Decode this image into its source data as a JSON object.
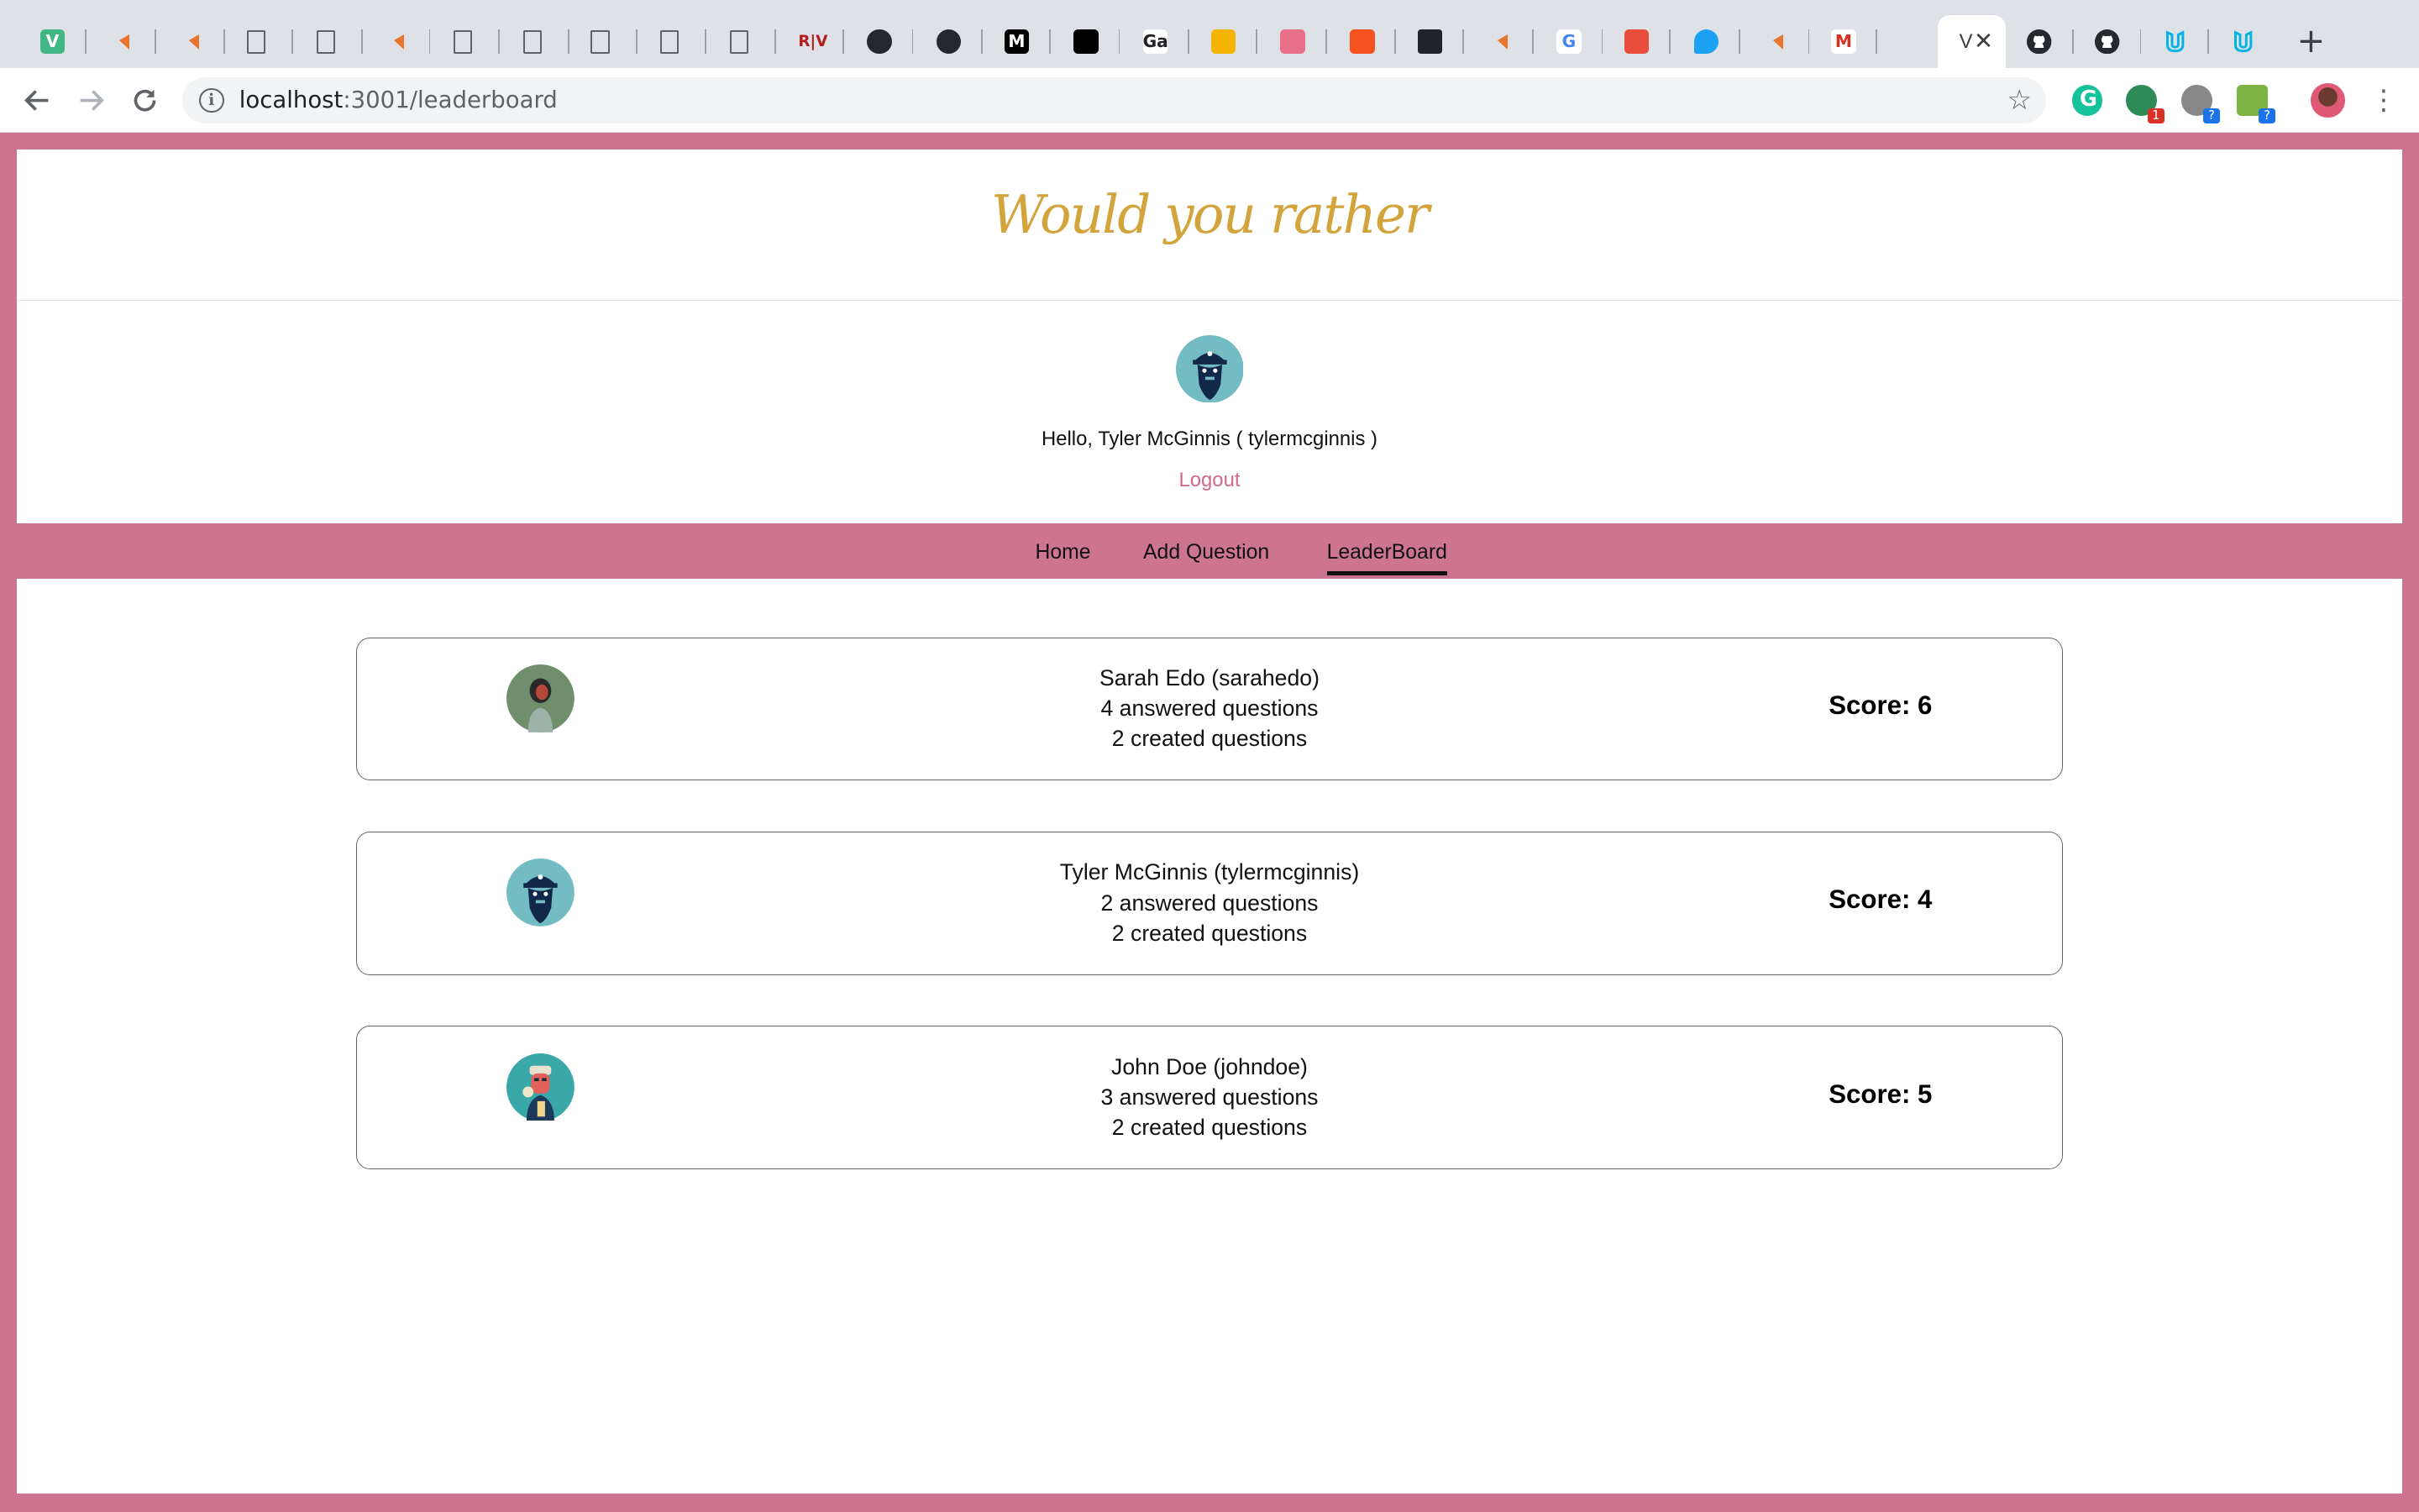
{
  "browser": {
    "tabs": [
      {
        "icon": "vue-icon",
        "label": "V",
        "color": "#41b883"
      },
      {
        "icon": "bookmark-arrow-icon",
        "label": "",
        "color": "#e8742d"
      },
      {
        "icon": "bookmark-arrow-icon",
        "label": "",
        "color": "#e8742d"
      },
      {
        "icon": "document-icon",
        "label": "",
        "color": "#5f6368"
      },
      {
        "icon": "document-icon",
        "label": "",
        "color": "#5f6368"
      },
      {
        "icon": "bookmark-arrow-icon",
        "label": "",
        "color": "#e8742d"
      },
      {
        "icon": "document-icon",
        "label": "",
        "color": "#5f6368"
      },
      {
        "icon": "document-icon",
        "label": "",
        "color": "#5f6368"
      },
      {
        "icon": "document-icon",
        "label": "",
        "color": "#5f6368"
      },
      {
        "icon": "document-icon",
        "label": "",
        "color": "#5f6368"
      },
      {
        "icon": "document-icon",
        "label": "",
        "color": "#5f6368"
      },
      {
        "icon": "rv-icon",
        "label": "R|V",
        "color": "#b31d1d"
      },
      {
        "icon": "github-icon",
        "label": "",
        "color": "#24292e"
      },
      {
        "icon": "github-icon",
        "label": "",
        "color": "#24292e"
      },
      {
        "icon": "medium-icon",
        "label": "M",
        "color": "#000000"
      },
      {
        "icon": "patreon-icon",
        "label": "",
        "color": "#000000"
      },
      {
        "icon": "ga-icon",
        "label": "Ga",
        "color": "#202124"
      },
      {
        "icon": "slides-icon",
        "label": "",
        "color": "#f4b400"
      },
      {
        "icon": "smile-icon",
        "label": "",
        "color": "#e86f8a"
      },
      {
        "icon": "laravel-icon",
        "label": "",
        "color": "#f4511e"
      },
      {
        "icon": "react-icon",
        "label": "",
        "color": "#61dafb"
      },
      {
        "icon": "bookmark-arrow-icon",
        "label": "",
        "color": "#e8742d"
      },
      {
        "icon": "google-icon",
        "label": "G",
        "color": "#4285f4"
      },
      {
        "icon": "stack-icon",
        "label": "",
        "color": "#e94e3d"
      },
      {
        "icon": "twitter-icon",
        "label": "",
        "color": "#1da1f2"
      },
      {
        "icon": "bookmark-arrow-icon",
        "label": "",
        "color": "#e8742d"
      },
      {
        "icon": "gmail-icon",
        "label": "M",
        "color": "#d93025"
      },
      {
        "icon": "audio-icon",
        "label": "",
        "color": "#5f6368"
      }
    ],
    "active_tab": {
      "label": "V",
      "close": "✕"
    },
    "trailing_tabs": [
      {
        "icon": "github-icon",
        "color": "#24292e"
      },
      {
        "icon": "github-icon",
        "color": "#24292e"
      },
      {
        "icon": "udacity-icon",
        "color": "#02b3e4"
      },
      {
        "icon": "udacity-icon",
        "color": "#02b3e4"
      }
    ],
    "new_tab": "+",
    "url_host": "localhost",
    "url_path": ":3001/leaderboard"
  },
  "app": {
    "title": "Would you rather",
    "greeting": "Hello, Tyler McGinnis ( tylermcginnis )",
    "logout": "Logout",
    "nav": {
      "home": "Home",
      "add_question": "Add Question",
      "leaderboard": "LeaderBoard"
    },
    "accent": "#cd7590",
    "brand_color": "#d2a43b"
  },
  "leaderboard": [
    {
      "name_line": "Sarah Edo (sarahedo)",
      "answered": "4 answered questions",
      "created": "2 created questions",
      "score": "Score: 6",
      "avatar": "woman-avatar-icon"
    },
    {
      "name_line": "Tyler McGinnis (tylermcginnis)",
      "answered": "2 answered questions",
      "created": "2 created questions",
      "score": "Score: 4",
      "avatar": "pirate-avatar-icon"
    },
    {
      "name_line": "John Doe (johndoe)",
      "answered": "3 answered questions",
      "created": "2 created questions",
      "score": "Score: 5",
      "avatar": "man-avatar-icon"
    }
  ]
}
